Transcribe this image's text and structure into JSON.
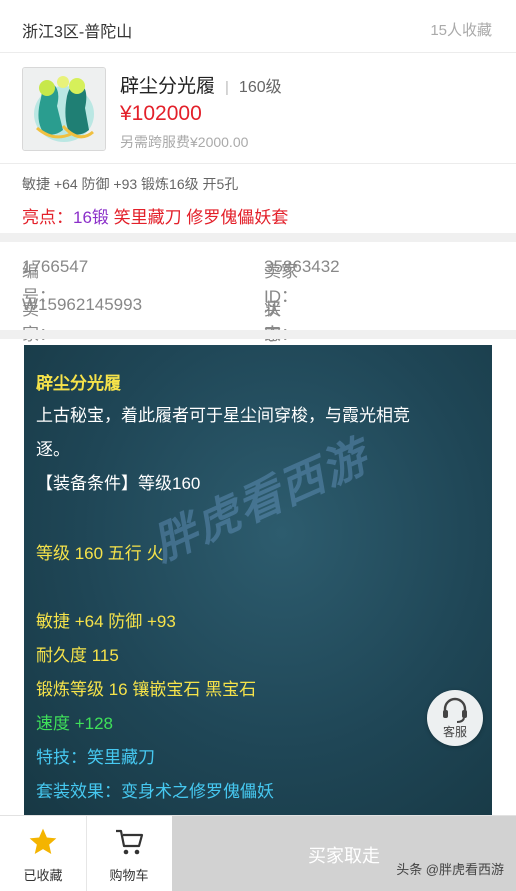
{
  "header": {
    "server": "浙江3区-普陀山",
    "favorites": "15人收藏"
  },
  "item": {
    "name": "辟尘分光履",
    "separator": "|",
    "level": "160级",
    "price": "¥102000",
    "cross_server_fee": "另需跨服费¥2000.00",
    "stats": "敏捷 +64 防御 +93 锻炼16级 开5孔",
    "highlight_label": "亮点：",
    "highlight_forge": "16锻",
    "highlight_skill": "笑里藏刀",
    "highlight_set": "修罗傀儡妖套"
  },
  "info": {
    "id_label": "编 号：",
    "id_value": "1766547",
    "seller_id_label": "卖家ID：",
    "seller_id_value": "35863432",
    "seller_label": "卖 家：",
    "seller_value": "W15962145993",
    "status_label": "状 态：",
    "status_value": "买家取走"
  },
  "detail": {
    "title": "辟尘分光履",
    "desc_line1": "上古秘宝，着此履者可于星尘间穿梭，与霞光相竞",
    "desc_line2": "逐。",
    "requirement": "【装备条件】等级160",
    "level_element": "等级 160 五行 火",
    "attr": "敏捷 +64 防御 +93",
    "durability": "耐久度 115",
    "forge": "锻炼等级 16 镶嵌宝石 黑宝石",
    "speed": "速度 +128",
    "skill": "特技：笑里藏刀",
    "set_effect": "套装效果：变身术之修罗傀儡妖",
    "watermark": "胖虎看西游"
  },
  "service": {
    "label": "客服"
  },
  "bottom_bar": {
    "favorited": "已收藏",
    "cart": "购物车",
    "buy": "买家取走"
  },
  "credit": "头条 @胖虎看西游",
  "colors": {
    "price_red": "#e3202a",
    "forge_purple": "#8b2fc9",
    "panel_bg": "#1f4656",
    "text_yellow": "#f5e24a",
    "text_white": "#ffffff",
    "text_green": "#3fe05a",
    "text_cyan": "#46c8f0",
    "star_gold": "#f4b400"
  },
  "icons": [
    "item-thumbnail-boots",
    "star-icon",
    "cart-icon",
    "headset-icon"
  ]
}
